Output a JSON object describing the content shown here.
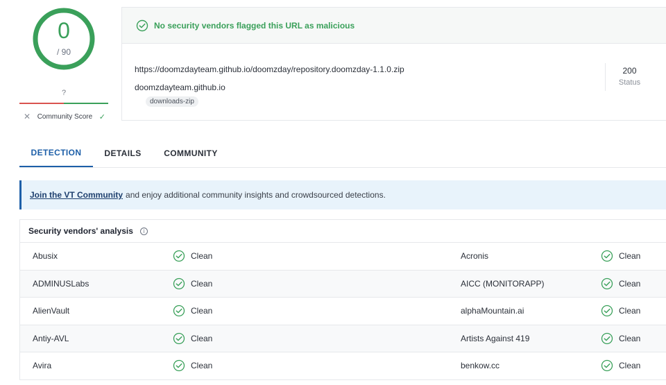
{
  "score": {
    "detections": "0",
    "total": "/ 90",
    "community_question": "?",
    "community_label": "Community Score",
    "dislike_glyph": "✕",
    "like_glyph": "✓",
    "ring_color": "#3aa05a"
  },
  "summary": {
    "message": "No security vendors flagged this URL as malicious",
    "url": "https://doomzdayteam.github.io/doomzday/repository.doomzday-1.1.0.zip",
    "domain": "doomzdayteam.github.io",
    "tag": "downloads-zip",
    "status_code": "200",
    "status_label": "Status"
  },
  "tabs": [
    {
      "label": "DETECTION",
      "active": true
    },
    {
      "label": "DETAILS",
      "active": false
    },
    {
      "label": "COMMUNITY",
      "active": false
    }
  ],
  "banner": {
    "link": "Join the VT Community",
    "text": "and enjoy additional community insights and crowdsourced detections."
  },
  "vendors": {
    "title": "Security vendors' analysis",
    "info_glyph": "i",
    "rows": [
      {
        "left_name": "Abusix",
        "left_result": "Clean",
        "right_name": "Acronis",
        "right_result": "Clean"
      },
      {
        "left_name": "ADMINUSLabs",
        "left_result": "Clean",
        "right_name": "AICC (MONITORAPP)",
        "right_result": "Clean"
      },
      {
        "left_name": "AlienVault",
        "left_result": "Clean",
        "right_name": "alphaMountain.ai",
        "right_result": "Clean"
      },
      {
        "left_name": "Antiy-AVL",
        "left_result": "Clean",
        "right_name": "Artists Against 419",
        "right_result": "Clean"
      },
      {
        "left_name": "Avira",
        "left_result": "Clean",
        "right_name": "benkow.cc",
        "right_result": "Clean"
      }
    ]
  },
  "colors": {
    "clean_green": "#3aa05a",
    "accent_blue": "#1d5fa8",
    "malicious_red": "#d9534f"
  }
}
